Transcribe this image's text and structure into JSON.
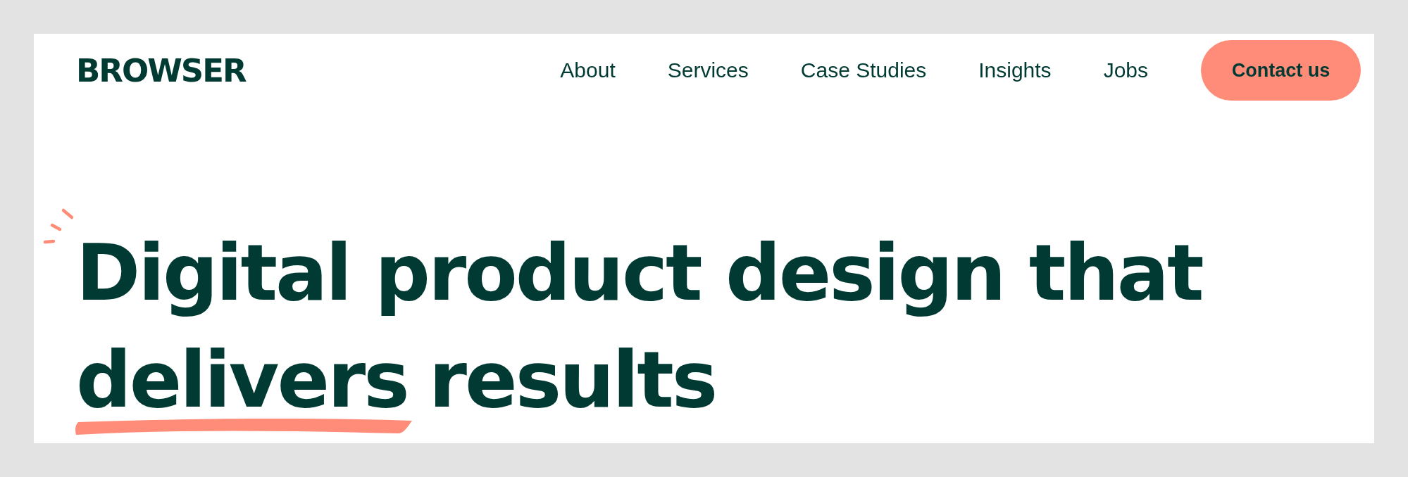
{
  "header": {
    "logo": "BROWSER",
    "nav": [
      {
        "label": "About"
      },
      {
        "label": "Services"
      },
      {
        "label": "Case Studies"
      },
      {
        "label": "Insights"
      },
      {
        "label": "Jobs"
      }
    ],
    "cta": "Contact us"
  },
  "hero": {
    "heading_start": "Digital product design that",
    "highlighted": "delivers",
    "heading_end": "results"
  }
}
